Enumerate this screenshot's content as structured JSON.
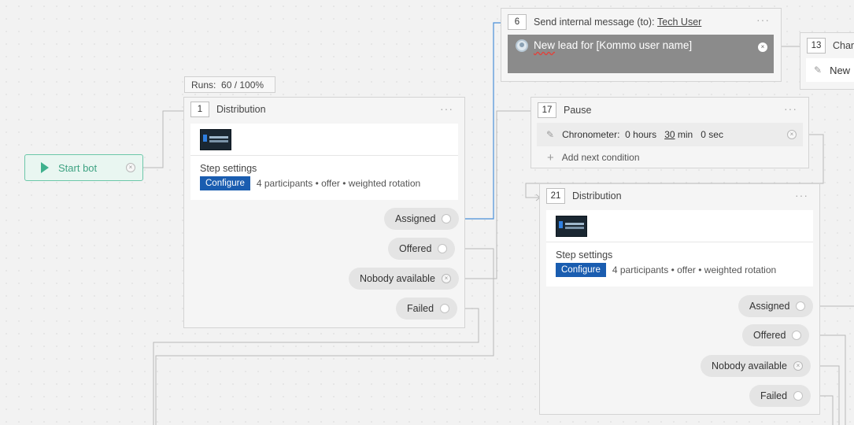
{
  "start": {
    "label": "Start bot",
    "close_glyph": "×"
  },
  "runs": {
    "label": "Runs:",
    "value": "60 / 100%"
  },
  "glyphs": {
    "more": "···",
    "close": "×",
    "plus": "+",
    "pencil": "✎"
  },
  "step1": {
    "number": "1",
    "title": "Distribution",
    "settings_title": "Step settings",
    "configure_label": "Configure",
    "summary": "4 participants • offer • weighted rotation",
    "outputs": [
      "Assigned",
      "Offered",
      "Nobody available",
      "Failed"
    ]
  },
  "step6": {
    "number": "6",
    "title_prefix": "Send internal message (to):",
    "recipient": "Tech User",
    "message_word1": "New",
    "message_rest": "lead for [Kommo user name]"
  },
  "step13": {
    "number": "13",
    "title": "Chang",
    "body": "New"
  },
  "step17": {
    "number": "17",
    "title": "Pause",
    "condition": {
      "label": "Chronometer:",
      "hours_value": "0",
      "hours_unit": "hours",
      "min_value": "30",
      "min_unit": "min",
      "sec_value": "0",
      "sec_unit": "sec"
    },
    "add_condition": "Add next condition"
  },
  "step21": {
    "number": "21",
    "title": "Distribution",
    "settings_title": "Step settings",
    "configure_label": "Configure",
    "summary": "4 participants • offer • weighted rotation",
    "outputs": [
      "Assigned",
      "Offered",
      "Nobody available",
      "Failed"
    ]
  },
  "colors": {
    "accent": "#1a5db0",
    "start_green": "#3fb08d",
    "wire": "#b5b5b5",
    "active_wire": "#4a90d9"
  }
}
